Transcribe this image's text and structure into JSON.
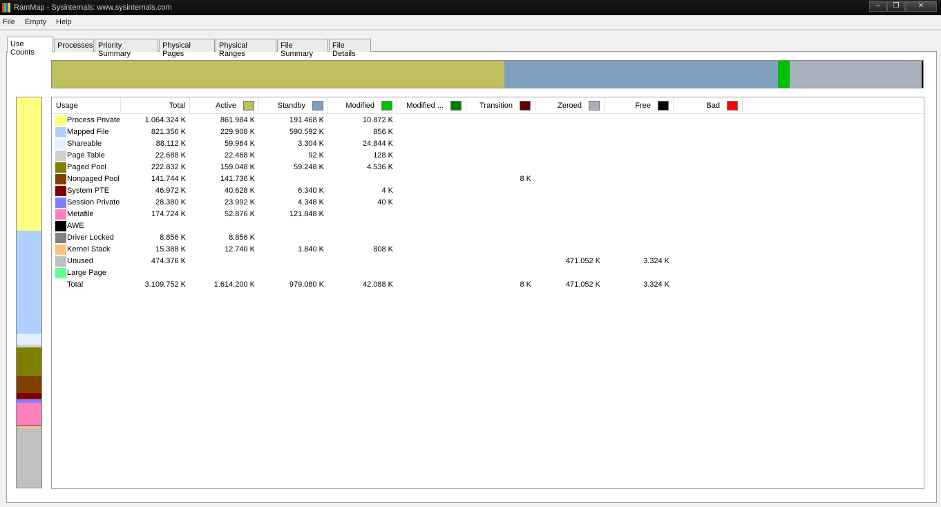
{
  "window": {
    "title": "RamMap - Sysinternals: www.sysinternals.com",
    "min": "–",
    "max": "❐",
    "close": "✕"
  },
  "menu": [
    "File",
    "Empty",
    "Help"
  ],
  "tabs": [
    "Use Counts",
    "Processes",
    "Priority Summary",
    "Physical Pages",
    "Physical Ranges",
    "File Summary",
    "File Details"
  ],
  "active_tab": 0,
  "columns": [
    {
      "label": "Usage",
      "color": null
    },
    {
      "label": "Total",
      "color": null
    },
    {
      "label": "Active",
      "color": "#bfbf5f"
    },
    {
      "label": "Standby",
      "color": "#7f9fbf"
    },
    {
      "label": "Modified",
      "color": "#00c000"
    },
    {
      "label": "Modified ...",
      "color": "#007f00"
    },
    {
      "label": "Transition",
      "color": "#600000"
    },
    {
      "label": "Zeroed",
      "color": "#a8b0bb"
    },
    {
      "label": "Free",
      "color": "#000000"
    },
    {
      "label": "Bad",
      "color": "#ff0000"
    }
  ],
  "rows": [
    {
      "name": "Process Private",
      "color": "#ffff80",
      "values": [
        "1.064.324 K",
        "861.984 K",
        "191.468 K",
        "10.872 K",
        "",
        "",
        "",
        "",
        ""
      ]
    },
    {
      "name": "Mapped File",
      "color": "#b0d0ff",
      "values": [
        "821.356 K",
        "229.908 K",
        "590.592 K",
        "856 K",
        "",
        "",
        "",
        "",
        ""
      ]
    },
    {
      "name": "Shareable",
      "color": "#e0f0ff",
      "values": [
        "88.112 K",
        "59.964 K",
        "3.304 K",
        "24.844 K",
        "",
        "",
        "",
        "",
        ""
      ]
    },
    {
      "name": "Page Table",
      "color": "#d0d0d0",
      "values": [
        "22.688 K",
        "22.468 K",
        "92 K",
        "128 K",
        "",
        "",
        "",
        "",
        ""
      ]
    },
    {
      "name": "Paged Pool",
      "color": "#808000",
      "values": [
        "222.832 K",
        "159.048 K",
        "59.248 K",
        "4.536 K",
        "",
        "",
        "",
        "",
        ""
      ]
    },
    {
      "name": "Nonpaged Pool",
      "color": "#804000",
      "values": [
        "141.744 K",
        "141.736 K",
        "",
        "",
        "",
        "8 K",
        "",
        "",
        ""
      ]
    },
    {
      "name": "System PTE",
      "color": "#800000",
      "values": [
        "46.972 K",
        "40.628 K",
        "6.340 K",
        "4 K",
        "",
        "",
        "",
        "",
        ""
      ]
    },
    {
      "name": "Session Private",
      "color": "#8080ff",
      "values": [
        "28.380 K",
        "23.992 K",
        "4.348 K",
        "40 K",
        "",
        "",
        "",
        "",
        ""
      ]
    },
    {
      "name": "Metafile",
      "color": "#ff80c0",
      "values": [
        "174.724 K",
        "52.876 K",
        "121.848 K",
        "",
        "",
        "",
        "",
        "",
        ""
      ]
    },
    {
      "name": "AWE",
      "color": "#000000",
      "values": [
        "",
        "",
        "",
        "",
        "",
        "",
        "",
        "",
        ""
      ]
    },
    {
      "name": "Driver Locked",
      "color": "#808080",
      "values": [
        "8.856 K",
        "8.856 K",
        "",
        "",
        "",
        "",
        "",
        "",
        ""
      ]
    },
    {
      "name": "Kernel Stack",
      "color": "#ffc080",
      "values": [
        "15.388 K",
        "12.740 K",
        "1.840 K",
        "808 K",
        "",
        "",
        "",
        "",
        ""
      ]
    },
    {
      "name": "Unused",
      "color": "#c0c0c0",
      "values": [
        "474.376 K",
        "",
        "",
        "",
        "",
        "",
        "471.052 K",
        "3.324 K",
        ""
      ]
    },
    {
      "name": "Large Page",
      "color": "#60ff90",
      "values": [
        "",
        "",
        "",
        "",
        "",
        "",
        "",
        "",
        ""
      ]
    },
    {
      "name": "Total",
      "color": null,
      "values": [
        "3.109.752 K",
        "1.614.200 K",
        "979.080 K",
        "42.088 K",
        "",
        "8 K",
        "471.052 K",
        "3.324 K",
        ""
      ]
    }
  ]
}
